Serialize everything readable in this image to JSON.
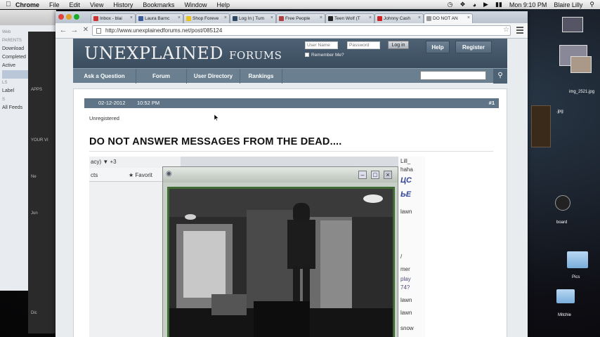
{
  "menubar": {
    "app": "Chrome",
    "items": [
      "File",
      "Edit",
      "View",
      "History",
      "Bookmarks",
      "Window",
      "Help"
    ],
    "clock": "Mon 9:10 PM",
    "user": "Blaire Lilly"
  },
  "finder": {
    "items": [
      "Web",
      "PARENTS",
      "Download",
      "Completed",
      "Active",
      "LS",
      "Label",
      "S",
      "All Feeds"
    ]
  },
  "dark_window": {
    "items": [
      "APPS",
      "YOUR VI",
      "Ne",
      "Jun",
      "Dic"
    ]
  },
  "desktop": {
    "icons": [
      {
        "label": "img_2521.jpg"
      },
      {
        "label": "Pics"
      },
      {
        "label": "Mitchie"
      },
      {
        "label": "board"
      },
      {
        "label": ".jpg"
      }
    ]
  },
  "browser": {
    "tabs": [
      {
        "label": "Inbox - blai",
        "fav_color": "#cc3333"
      },
      {
        "label": "Laura Barnc",
        "fav_color": "#3b5998"
      },
      {
        "label": "Shop Foreve",
        "fav_color": "#e8c020"
      },
      {
        "label": "Log In | Tum",
        "fav_color": "#2c4762"
      },
      {
        "label": "Free People",
        "fav_color": "#b04040"
      },
      {
        "label": "Teen Wolf (T",
        "fav_color": "#222222"
      },
      {
        "label": "Johnny Cash",
        "fav_color": "#cc2222"
      },
      {
        "label": "DO NOT AN",
        "fav_color": "#999999"
      }
    ],
    "url": "http://www.unexplainedforums.net/post/085124"
  },
  "site": {
    "logo_main": "UNEXPLAINED",
    "logo_sub": "FORUMS",
    "username_placeholder": "User Name",
    "password_placeholder": "Password",
    "login_label": "Log in",
    "remember_label": "Remember Me?",
    "help_label": "Help",
    "register_label": "Register",
    "nav": [
      "Ask a Question",
      "Forum",
      "User Directory",
      "Rankings"
    ]
  },
  "post": {
    "date": "02-12-2012",
    "time": "10:52 PM",
    "number": "#1",
    "user": "Unregistered",
    "title": "DO NOT ANSWER MESSAGES FROM THE DEAD....",
    "embedded": {
      "left_text": "acy)",
      "count": "+3",
      "tab_left": "cts",
      "tab_fav": "Favorit",
      "right_lines": [
        {
          "text": "Lill_",
          "style": "plain"
        },
        {
          "text": "haha",
          "style": "plain"
        },
        {
          "text": "ЦС",
          "style": "blue"
        },
        {
          "text": "ЬЕ",
          "style": "blue"
        },
        {
          "text": "lawn",
          "style": "plain"
        },
        {
          "text": "/",
          "style": "plain"
        },
        {
          "text": "mer",
          "style": "plain"
        },
        {
          "text": "play",
          "style": "lnk"
        },
        {
          "text": "74?",
          "style": "lnk"
        },
        {
          "text": "lawn",
          "style": "plain"
        },
        {
          "text": "lawn",
          "style": "plain"
        },
        {
          "text": "snow",
          "style": "plain"
        }
      ]
    }
  }
}
